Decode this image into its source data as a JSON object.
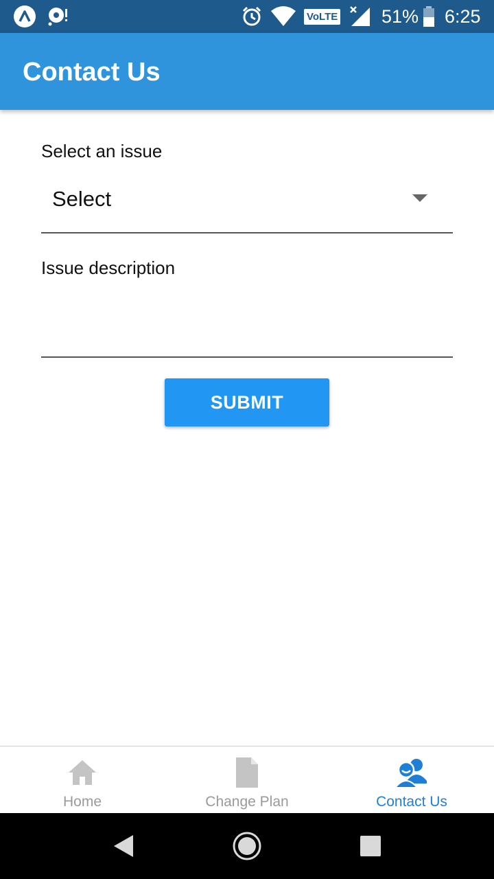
{
  "status_bar": {
    "battery": "51%",
    "time": "6:25",
    "network_badge": "VoLTE",
    "icons": [
      "app-a-icon",
      "media-icon",
      "alarm-icon",
      "wifi-icon",
      "volte-icon",
      "signal-icon",
      "battery-icon"
    ]
  },
  "app_bar": {
    "title": "Contact Us"
  },
  "form": {
    "issue_label": "Select an issue",
    "issue_value": "Select",
    "description_label": "Issue description",
    "submit_label": "SUBMIT"
  },
  "tabs": [
    {
      "label": "Home",
      "icon": "home-icon",
      "active": false
    },
    {
      "label": "Change Plan",
      "icon": "document-icon",
      "active": false
    },
    {
      "label": "Contact Us",
      "icon": "contact-people-icon",
      "active": true
    }
  ],
  "colors": {
    "status_bar": "#1f5a8c",
    "app_bar": "#2f94dc",
    "button": "#2196f3",
    "active_tab": "#1f7fd6",
    "inactive_tab": "#9a9a9a"
  },
  "nav_bar": {
    "icons": [
      "back-icon",
      "home-circle-icon",
      "recents-icon"
    ]
  }
}
